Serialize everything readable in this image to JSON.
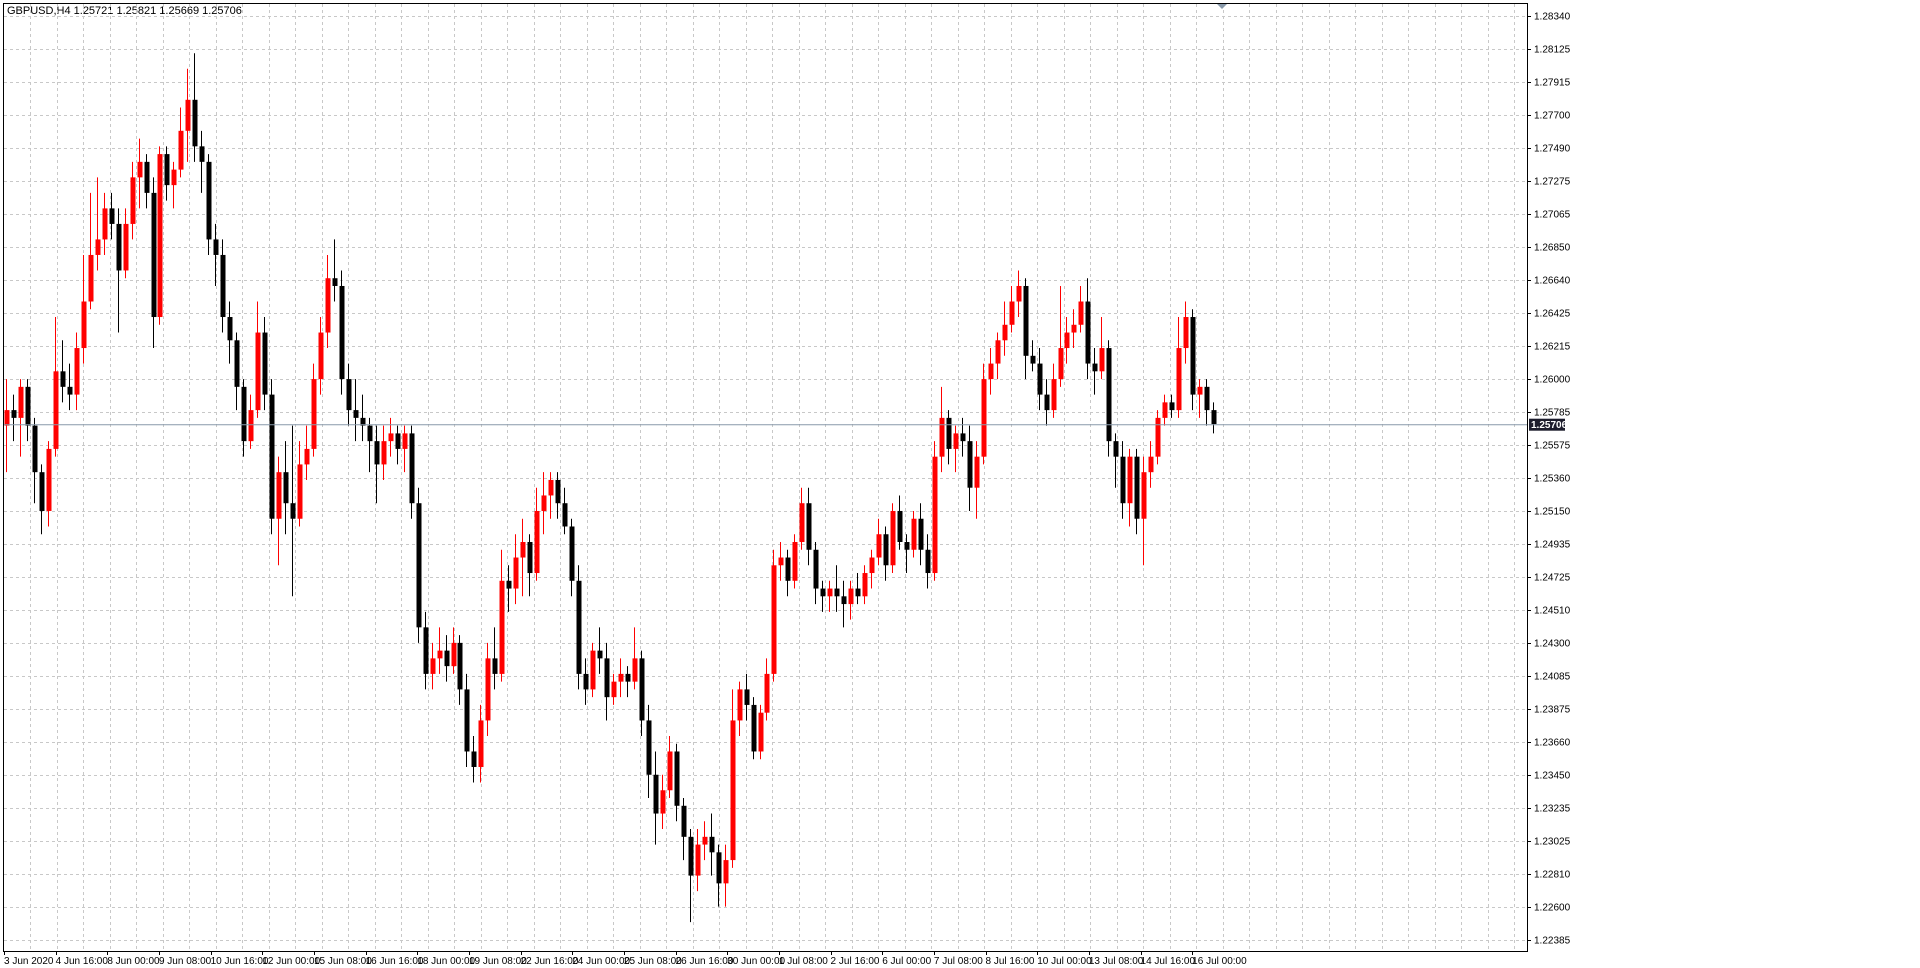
{
  "chart_info": {
    "symbol": "GBPUSD,H4",
    "open": "1.25721",
    "high": "1.25821",
    "low": "1.25669",
    "close": "1.25706"
  },
  "colors": {
    "background": "#ffffff",
    "grid": "#c8c8c8",
    "bull_candle": "#ff0000",
    "bear_candle": "#000000",
    "bid_line": "#8899aa",
    "price_tag_bg": "#1c1c2c"
  },
  "chart_data": {
    "type": "candlestick",
    "symbol": "GBPUSD",
    "timeframe": "H4",
    "current_price": 1.25706,
    "ylim": [
      1.22385,
      1.2834
    ],
    "y_tick_labels": [
      "1.28340",
      "1.28125",
      "1.27915",
      "1.27700",
      "1.27490",
      "1.27275",
      "1.27065",
      "1.26850",
      "1.26640",
      "1.26425",
      "1.26215",
      "1.26000",
      "1.25785",
      "1.25575",
      "1.25360",
      "1.25150",
      "1.24935",
      "1.24725",
      "1.24510",
      "1.24300",
      "1.24085",
      "1.23875",
      "1.23660",
      "1.23450",
      "1.23235",
      "1.23025",
      "1.22810",
      "1.22600",
      "1.22385"
    ],
    "x_tick_labels": [
      "3 Jun 2020",
      "4 Jun 16:00",
      "8 Jun 00:00",
      "9 Jun 08:00",
      "10 Jun 16:00",
      "12 Jun 00:00",
      "15 Jun 08:00",
      "16 Jun 16:00",
      "18 Jun 00:00",
      "19 Jun 08:00",
      "22 Jun 16:00",
      "24 Jun 00:00",
      "25 Jun 08:00",
      "26 Jun 16:00",
      "30 Jun 00:00",
      "1 Jul 08:00",
      "2 Jul 16:00",
      "6 Jul 00:00",
      "7 Jul 08:00",
      "8 Jul 16:00",
      "10 Jul 00:00",
      "13 Jul 08:00",
      "14 Jul 16:00",
      "16 Jul 00:00"
    ],
    "grid": true,
    "candles": [
      [
        1.257,
        1.26,
        1.254,
        1.258
      ],
      [
        1.258,
        1.259,
        1.256,
        1.2575
      ],
      [
        1.2575,
        1.26,
        1.255,
        1.2595
      ],
      [
        1.2595,
        1.26,
        1.256,
        1.257
      ],
      [
        1.257,
        1.2575,
        1.252,
        1.254
      ],
      [
        1.254,
        1.2545,
        1.25,
        1.2515
      ],
      [
        1.2515,
        1.256,
        1.2505,
        1.2555
      ],
      [
        1.2555,
        1.264,
        1.255,
        1.2605
      ],
      [
        1.2605,
        1.2625,
        1.2585,
        1.2595
      ],
      [
        1.2595,
        1.261,
        1.258,
        1.259
      ],
      [
        1.259,
        1.263,
        1.258,
        1.262
      ],
      [
        1.262,
        1.268,
        1.261,
        1.265
      ],
      [
        1.265,
        1.272,
        1.2645,
        1.268
      ],
      [
        1.268,
        1.273,
        1.267,
        1.269
      ],
      [
        1.269,
        1.272,
        1.268,
        1.271
      ],
      [
        1.271,
        1.272,
        1.269,
        1.27
      ],
      [
        1.27,
        1.271,
        1.263,
        1.267
      ],
      [
        1.267,
        1.271,
        1.2665,
        1.27
      ],
      [
        1.27,
        1.274,
        1.269,
        1.273
      ],
      [
        1.273,
        1.2755,
        1.271,
        1.274
      ],
      [
        1.274,
        1.2745,
        1.271,
        1.272
      ],
      [
        1.272,
        1.273,
        1.262,
        1.264
      ],
      [
        1.264,
        1.275,
        1.2635,
        1.2745
      ],
      [
        1.2745,
        1.275,
        1.2715,
        1.2725
      ],
      [
        1.2725,
        1.274,
        1.271,
        1.2735
      ],
      [
        1.2735,
        1.2775,
        1.273,
        1.276
      ],
      [
        1.276,
        1.28,
        1.274,
        1.278
      ],
      [
        1.278,
        1.281,
        1.274,
        1.275
      ],
      [
        1.275,
        1.276,
        1.272,
        1.274
      ],
      [
        1.274,
        1.2745,
        1.268,
        1.269
      ],
      [
        1.269,
        1.27,
        1.266,
        1.268
      ],
      [
        1.268,
        1.269,
        1.263,
        1.264
      ],
      [
        1.264,
        1.265,
        1.261,
        1.2625
      ],
      [
        1.2625,
        1.263,
        1.258,
        1.2595
      ],
      [
        1.2595,
        1.26,
        1.255,
        1.256
      ],
      [
        1.256,
        1.259,
        1.2555,
        1.258
      ],
      [
        1.258,
        1.265,
        1.2575,
        1.263
      ],
      [
        1.263,
        1.264,
        1.258,
        1.259
      ],
      [
        1.259,
        1.26,
        1.25,
        1.251
      ],
      [
        1.251,
        1.255,
        1.248,
        1.254
      ],
      [
        1.254,
        1.256,
        1.25,
        1.252
      ],
      [
        1.252,
        1.257,
        1.246,
        1.251
      ],
      [
        1.251,
        1.256,
        1.2505,
        1.2545
      ],
      [
        1.2545,
        1.257,
        1.2535,
        1.2555
      ],
      [
        1.2555,
        1.261,
        1.255,
        1.26
      ],
      [
        1.26,
        1.264,
        1.259,
        1.263
      ],
      [
        1.263,
        1.268,
        1.262,
        1.2665
      ],
      [
        1.2665,
        1.269,
        1.265,
        1.266
      ],
      [
        1.266,
        1.267,
        1.259,
        1.26
      ],
      [
        1.26,
        1.261,
        1.257,
        1.258
      ],
      [
        1.258,
        1.26,
        1.256,
        1.2575
      ],
      [
        1.2575,
        1.259,
        1.256,
        1.257
      ],
      [
        1.257,
        1.2575,
        1.254,
        1.256
      ],
      [
        1.256,
        1.257,
        1.252,
        1.2545
      ],
      [
        1.2545,
        1.257,
        1.2535,
        1.256
      ],
      [
        1.256,
        1.2575,
        1.255,
        1.2565
      ],
      [
        1.2565,
        1.257,
        1.2545,
        1.2555
      ],
      [
        1.2555,
        1.257,
        1.254,
        1.2565
      ],
      [
        1.2565,
        1.257,
        1.251,
        1.252
      ],
      [
        1.252,
        1.253,
        1.243,
        1.244
      ],
      [
        1.244,
        1.245,
        1.24,
        1.241
      ],
      [
        1.241,
        1.243,
        1.24,
        1.242
      ],
      [
        1.242,
        1.244,
        1.241,
        1.2425
      ],
      [
        1.2425,
        1.2435,
        1.2405,
        1.2415
      ],
      [
        1.2415,
        1.244,
        1.241,
        1.243
      ],
      [
        1.243,
        1.2435,
        1.239,
        1.24
      ],
      [
        1.24,
        1.241,
        1.235,
        1.236
      ],
      [
        1.236,
        1.237,
        1.234,
        1.235
      ],
      [
        1.235,
        1.239,
        1.234,
        1.238
      ],
      [
        1.238,
        1.243,
        1.237,
        1.242
      ],
      [
        1.242,
        1.244,
        1.24,
        1.241
      ],
      [
        1.241,
        1.249,
        1.2405,
        1.247
      ],
      [
        1.247,
        1.248,
        1.245,
        1.2465
      ],
      [
        1.2465,
        1.25,
        1.2455,
        1.2485
      ],
      [
        1.2485,
        1.251,
        1.246,
        1.2495
      ],
      [
        1.2495,
        1.25,
        1.246,
        1.2475
      ],
      [
        1.2475,
        1.253,
        1.247,
        1.2515
      ],
      [
        1.2515,
        1.254,
        1.25,
        1.2525
      ],
      [
        1.2525,
        1.254,
        1.251,
        1.2535
      ],
      [
        1.2535,
        1.254,
        1.251,
        1.252
      ],
      [
        1.252,
        1.253,
        1.25,
        1.2505
      ],
      [
        1.2505,
        1.251,
        1.246,
        1.247
      ],
      [
        1.247,
        1.248,
        1.24,
        1.241
      ],
      [
        1.241,
        1.242,
        1.239,
        1.24
      ],
      [
        1.24,
        1.243,
        1.2395,
        1.2425
      ],
      [
        1.2425,
        1.244,
        1.241,
        1.242
      ],
      [
        1.242,
        1.243,
        1.238,
        1.2395
      ],
      [
        1.2395,
        1.241,
        1.239,
        1.2405
      ],
      [
        1.2405,
        1.242,
        1.2395,
        1.241
      ],
      [
        1.241,
        1.2415,
        1.2395,
        1.2405
      ],
      [
        1.2405,
        1.244,
        1.24,
        1.242
      ],
      [
        1.242,
        1.2425,
        1.237,
        1.238
      ],
      [
        1.238,
        1.239,
        1.233,
        1.2345
      ],
      [
        1.2345,
        1.236,
        1.23,
        1.232
      ],
      [
        1.232,
        1.2345,
        1.231,
        1.2335
      ],
      [
        1.2335,
        1.237,
        1.233,
        1.236
      ],
      [
        1.236,
        1.2365,
        1.2315,
        1.2325
      ],
      [
        1.2325,
        1.233,
        1.229,
        1.2305
      ],
      [
        1.2305,
        1.231,
        1.225,
        1.228
      ],
      [
        1.228,
        1.231,
        1.227,
        1.23
      ],
      [
        1.23,
        1.2315,
        1.229,
        1.2305
      ],
      [
        1.2305,
        1.232,
        1.228,
        1.2295
      ],
      [
        1.2295,
        1.23,
        1.226,
        1.2275
      ],
      [
        1.2275,
        1.23,
        1.226,
        1.229
      ],
      [
        1.229,
        1.24,
        1.2285,
        1.238
      ],
      [
        1.238,
        1.2405,
        1.237,
        1.24
      ],
      [
        1.24,
        1.241,
        1.238,
        1.239
      ],
      [
        1.239,
        1.2395,
        1.2355,
        1.236
      ],
      [
        1.236,
        1.239,
        1.2355,
        1.2385
      ],
      [
        1.2385,
        1.242,
        1.238,
        1.241
      ],
      [
        1.241,
        1.249,
        1.2405,
        1.248
      ],
      [
        1.248,
        1.2495,
        1.247,
        1.2485
      ],
      [
        1.2485,
        1.249,
        1.246,
        1.247
      ],
      [
        1.247,
        1.25,
        1.2465,
        1.2495
      ],
      [
        1.2495,
        1.253,
        1.249,
        1.252
      ],
      [
        1.252,
        1.253,
        1.248,
        1.249
      ],
      [
        1.249,
        1.2495,
        1.2455,
        1.2465
      ],
      [
        1.2465,
        1.247,
        1.245,
        1.246
      ],
      [
        1.246,
        1.247,
        1.245,
        1.2465
      ],
      [
        1.2465,
        1.248,
        1.245,
        1.246
      ],
      [
        1.246,
        1.247,
        1.244,
        1.2455
      ],
      [
        1.2455,
        1.247,
        1.2445,
        1.2465
      ],
      [
        1.2465,
        1.2475,
        1.2455,
        1.246
      ],
      [
        1.246,
        1.248,
        1.2455,
        1.2475
      ],
      [
        1.2475,
        1.249,
        1.2465,
        1.2485
      ],
      [
        1.2485,
        1.251,
        1.248,
        1.25
      ],
      [
        1.25,
        1.2505,
        1.247,
        1.248
      ],
      [
        1.248,
        1.252,
        1.2475,
        1.2515
      ],
      [
        1.2515,
        1.2525,
        1.249,
        1.2495
      ],
      [
        1.2495,
        1.25,
        1.2475,
        1.249
      ],
      [
        1.249,
        1.2515,
        1.2485,
        1.251
      ],
      [
        1.251,
        1.252,
        1.248,
        1.249
      ],
      [
        1.249,
        1.25,
        1.2465,
        1.2475
      ],
      [
        1.2475,
        1.256,
        1.247,
        1.255
      ],
      [
        1.255,
        1.2595,
        1.254,
        1.2575
      ],
      [
        1.2575,
        1.258,
        1.2545,
        1.2555
      ],
      [
        1.2555,
        1.257,
        1.254,
        1.2565
      ],
      [
        1.2565,
        1.2575,
        1.255,
        1.256
      ],
      [
        1.256,
        1.257,
        1.2515,
        1.253
      ],
      [
        1.253,
        1.256,
        1.251,
        1.255
      ],
      [
        1.255,
        1.261,
        1.2545,
        1.26
      ],
      [
        1.26,
        1.262,
        1.259,
        1.261
      ],
      [
        1.261,
        1.263,
        1.26,
        1.2625
      ],
      [
        1.2625,
        1.265,
        1.2615,
        1.2635
      ],
      [
        1.2635,
        1.266,
        1.263,
        1.265
      ],
      [
        1.265,
        1.267,
        1.264,
        1.266
      ],
      [
        1.266,
        1.2665,
        1.26,
        1.2615
      ],
      [
        1.2615,
        1.2625,
        1.2605,
        1.261
      ],
      [
        1.261,
        1.262,
        1.258,
        1.259
      ],
      [
        1.259,
        1.26,
        1.257,
        1.258
      ],
      [
        1.258,
        1.261,
        1.2575,
        1.26
      ],
      [
        1.26,
        1.266,
        1.2595,
        1.262
      ],
      [
        1.262,
        1.264,
        1.261,
        1.263
      ],
      [
        1.263,
        1.2645,
        1.262,
        1.2635
      ],
      [
        1.2635,
        1.266,
        1.263,
        1.265
      ],
      [
        1.265,
        1.2665,
        1.26,
        1.261
      ],
      [
        1.261,
        1.262,
        1.259,
        1.2605
      ],
      [
        1.2605,
        1.264,
        1.26,
        1.262
      ],
      [
        1.262,
        1.2625,
        1.255,
        1.256
      ],
      [
        1.256,
        1.2565,
        1.253,
        1.255
      ],
      [
        1.255,
        1.256,
        1.251,
        1.252
      ],
      [
        1.252,
        1.2555,
        1.2505,
        1.255
      ],
      [
        1.255,
        1.2555,
        1.25,
        1.251
      ],
      [
        1.251,
        1.255,
        1.248,
        1.254
      ],
      [
        1.254,
        1.256,
        1.253,
        1.255
      ],
      [
        1.255,
        1.258,
        1.2545,
        1.2575
      ],
      [
        1.2575,
        1.259,
        1.257,
        1.2585
      ],
      [
        1.2585,
        1.259,
        1.2575,
        1.258
      ],
      [
        1.258,
        1.264,
        1.2575,
        1.262
      ],
      [
        1.262,
        1.265,
        1.261,
        1.264
      ],
      [
        1.264,
        1.2645,
        1.258,
        1.259
      ],
      [
        1.259,
        1.26,
        1.2575,
        1.2595
      ],
      [
        1.2595,
        1.26,
        1.257,
        1.258
      ],
      [
        1.258,
        1.2585,
        1.2565,
        1.2571
      ]
    ]
  }
}
